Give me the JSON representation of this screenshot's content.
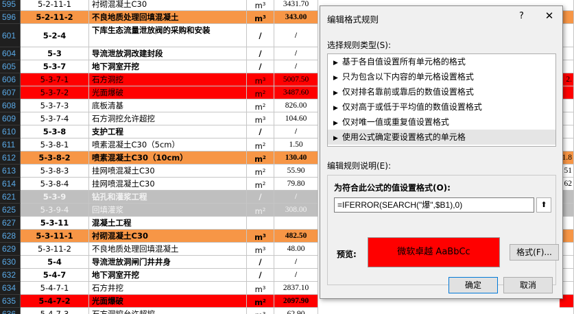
{
  "rows": [
    {
      "num": "595",
      "code": "5-2-11-1",
      "name": "衬砌混凝土C30",
      "unit": "m",
      "sup": "3",
      "qty": "3431.70",
      "tail": "",
      "style": "white",
      "bold": false
    },
    {
      "num": "596",
      "code": "5-2-11-2",
      "name": "不良地质处理回填混凝土",
      "unit": "m",
      "sup": "3",
      "qty": "343.00",
      "tail": "",
      "style": "orange",
      "bold": true
    },
    {
      "num": "601",
      "code": "5-2-4",
      "name": "下库生态流量泄放阀的采购和安装",
      "unit": "/",
      "sup": "",
      "qty": "/",
      "tail": "",
      "style": "white",
      "bold": true,
      "tall": true
    },
    {
      "num": "604",
      "code": "5-3",
      "name": "导流泄放洞改建封段",
      "unit": "/",
      "sup": "",
      "qty": "/",
      "tail": "",
      "style": "white",
      "bold": true
    },
    {
      "num": "605",
      "code": "5-3-7",
      "name": "地下洞室开挖",
      "unit": "/",
      "sup": "",
      "qty": "/",
      "tail": "",
      "style": "white",
      "bold": true
    },
    {
      "num": "606",
      "code": "5-3-7-1",
      "name": "石方洞挖",
      "unit": "m",
      "sup": "3",
      "qty": "5007.50",
      "tail": "2.",
      "style": "red",
      "bold": false
    },
    {
      "num": "607",
      "code": "5-3-7-2",
      "name": "光面爆破",
      "unit": "m",
      "sup": "2",
      "qty": "3487.60",
      "tail": "",
      "style": "red",
      "bold": false
    },
    {
      "num": "608",
      "code": "5-3-7-3",
      "name": "底板清基",
      "unit": "m",
      "sup": "2",
      "qty": "826.00",
      "tail": "",
      "style": "white",
      "bold": false
    },
    {
      "num": "609",
      "code": "5-3-7-4",
      "name": "石方洞挖允许超挖",
      "unit": "m",
      "sup": "3",
      "qty": "104.60",
      "tail": "",
      "style": "white",
      "bold": false
    },
    {
      "num": "610",
      "code": "5-3-8",
      "name": "支护工程",
      "unit": "/",
      "sup": "",
      "qty": "/",
      "tail": "",
      "style": "white",
      "bold": true
    },
    {
      "num": "611",
      "code": "5-3-8-1",
      "name": "喷素混凝土C30（5cm）",
      "unit": "m",
      "sup": "2",
      "qty": "1.50",
      "tail": "",
      "style": "white",
      "bold": false
    },
    {
      "num": "612",
      "code": "5-3-8-2",
      "name": "喷素混凝土C30（10cm）",
      "unit": "m",
      "sup": "2",
      "qty": "130.40",
      "tail": "1.8",
      "style": "orange",
      "bold": true
    },
    {
      "num": "613",
      "code": "5-3-8-3",
      "name": "挂网喷混凝土C30",
      "unit": "m",
      "sup": "2",
      "qty": "55.90",
      "tail": "51",
      "style": "white",
      "bold": false
    },
    {
      "num": "614",
      "code": "5-3-8-4",
      "name": "挂网喷混凝土C30",
      "unit": "m",
      "sup": "2",
      "qty": "79.80",
      "tail": "62",
      "style": "white",
      "bold": false
    },
    {
      "num": "621",
      "code": "5-3-9",
      "name": "钻孔和灌浆工程",
      "unit": "/",
      "sup": "",
      "qty": "/",
      "tail": "",
      "style": "gray",
      "bold": true
    },
    {
      "num": "625",
      "code": "5-3-9-4",
      "name": "回填灌浆",
      "unit": "m",
      "sup": "2",
      "qty": "308.00",
      "tail": "",
      "style": "gray",
      "bold": false
    },
    {
      "num": "627",
      "code": "5-3-11",
      "name": "混凝土工程",
      "unit": "",
      "sup": "",
      "qty": "",
      "tail": "",
      "style": "white",
      "bold": true
    },
    {
      "num": "628",
      "code": "5-3-11-1",
      "name": "衬砌混凝土C30",
      "unit": "m",
      "sup": "3",
      "qty": "482.50",
      "tail": "",
      "style": "orange",
      "bold": true
    },
    {
      "num": "629",
      "code": "5-3-11-2",
      "name": "不良地质处理回填混凝土",
      "unit": "m",
      "sup": "3",
      "qty": "48.00",
      "tail": "",
      "style": "white",
      "bold": false
    },
    {
      "num": "630",
      "code": "5-4",
      "name": "导流泄放洞闸门井井身",
      "unit": "/",
      "sup": "",
      "qty": "/",
      "tail": "",
      "style": "white",
      "bold": true
    },
    {
      "num": "632",
      "code": "5-4-7",
      "name": "地下洞室开挖",
      "unit": "/",
      "sup": "",
      "qty": "/",
      "tail": "",
      "style": "white",
      "bold": true
    },
    {
      "num": "634",
      "code": "5-4-7-1",
      "name": "石方井挖",
      "unit": "m",
      "sup": "3",
      "qty": "2837.10",
      "tail": "",
      "style": "white",
      "bold": false
    },
    {
      "num": "635",
      "code": "5-4-7-2",
      "name": "光面爆破",
      "unit": "m",
      "sup": "2",
      "qty": "2097.90",
      "tail": "",
      "style": "red",
      "bold": true
    },
    {
      "num": "636",
      "code": "5-4-7-3",
      "name": "石方洞挖允许超挖",
      "unit": "m",
      "sup": "3",
      "qty": "62.90",
      "tail": "",
      "style": "white",
      "bold": false
    }
  ],
  "dialog": {
    "title": "编辑格式规则",
    "help": "?",
    "close": "✕",
    "select_label": "选择规则类型(S):",
    "rule_types": [
      "基于各自值设置所有单元格的格式",
      "只为包含以下内容的单元格设置格式",
      "仅对排名靠前或靠后的数值设置格式",
      "仅对高于或低于平均值的数值设置格式",
      "仅对唯一值或重复值设置格式",
      "使用公式确定要设置格式的单元格"
    ],
    "desc_label": "编辑规则说明(E):",
    "formula_title": "为符合此公式的值设置格式(O):",
    "formula": "=IFERROR(SEARCH(\"爆\",$B1),0)",
    "preview_label": "预览:",
    "preview_text": "微软卓越  AaBbCc",
    "format_button": "格式(F)...",
    "ok_button": "确定",
    "cancel_button": "取消"
  }
}
